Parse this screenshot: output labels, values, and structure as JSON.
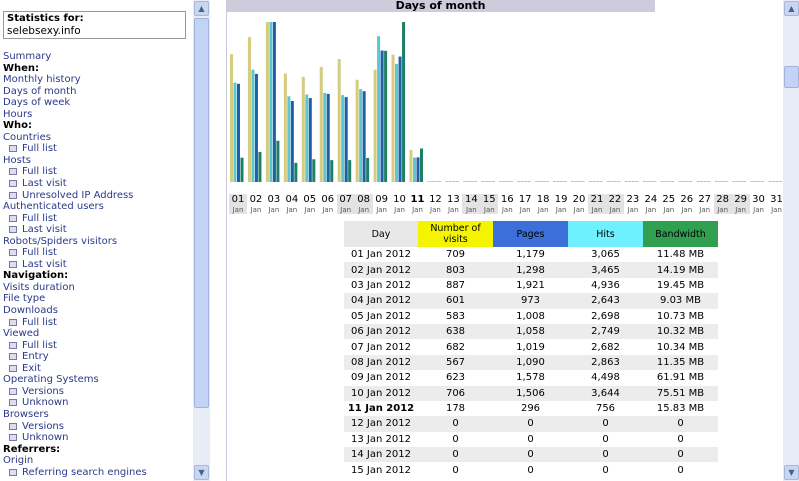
{
  "sidebar": {
    "stats_for_label": "Statistics for:",
    "domain": "selebsexy.info",
    "items": [
      {
        "label": "Summary",
        "type": "link"
      },
      {
        "label": "When:",
        "type": "head"
      },
      {
        "label": "Monthly history",
        "type": "link"
      },
      {
        "label": "Days of month",
        "type": "link"
      },
      {
        "label": "Days of week",
        "type": "link"
      },
      {
        "label": "Hours",
        "type": "link"
      },
      {
        "label": "Who:",
        "type": "head"
      },
      {
        "label": "Countries",
        "type": "link"
      },
      {
        "label": "Full list",
        "type": "sub"
      },
      {
        "label": "Hosts",
        "type": "link"
      },
      {
        "label": "Full list",
        "type": "sub"
      },
      {
        "label": "Last visit",
        "type": "sub"
      },
      {
        "label": "Unresolved IP Address",
        "type": "sub"
      },
      {
        "label": "Authenticated users",
        "type": "link"
      },
      {
        "label": "Full list",
        "type": "sub"
      },
      {
        "label": "Last visit",
        "type": "sub"
      },
      {
        "label": "Robots/Spiders visitors",
        "type": "link"
      },
      {
        "label": "Full list",
        "type": "sub"
      },
      {
        "label": "Last visit",
        "type": "sub"
      },
      {
        "label": "Navigation:",
        "type": "head"
      },
      {
        "label": "Visits duration",
        "type": "link"
      },
      {
        "label": "File type",
        "type": "link"
      },
      {
        "label": "Downloads",
        "type": "link"
      },
      {
        "label": "Full list",
        "type": "sub"
      },
      {
        "label": "Viewed",
        "type": "link"
      },
      {
        "label": "Full list",
        "type": "sub"
      },
      {
        "label": "Entry",
        "type": "sub"
      },
      {
        "label": "Exit",
        "type": "sub"
      },
      {
        "label": "Operating Systems",
        "type": "link"
      },
      {
        "label": "Versions",
        "type": "sub"
      },
      {
        "label": "Unknown",
        "type": "sub"
      },
      {
        "label": "Browsers",
        "type": "link"
      },
      {
        "label": "Versions",
        "type": "sub"
      },
      {
        "label": "Unknown",
        "type": "sub"
      },
      {
        "label": "Referrers:",
        "type": "head"
      },
      {
        "label": "Origin",
        "type": "link"
      },
      {
        "label": "Referring search engines",
        "type": "sub"
      }
    ]
  },
  "main": {
    "section_title": "Days of month"
  },
  "colors": {
    "visits": "#d4cc7e",
    "pages": "#1f5fa8",
    "hits": "#5cc6d2",
    "bandwidth": "#1c7f66"
  },
  "chart_data": {
    "type": "bar",
    "month_label": "Jan",
    "today_index": 10,
    "weekend_days": [
      1,
      7,
      8,
      14,
      15,
      21,
      22,
      28,
      29
    ],
    "categories": [
      "01",
      "02",
      "03",
      "04",
      "05",
      "06",
      "07",
      "08",
      "09",
      "10",
      "11",
      "12",
      "13",
      "14",
      "15",
      "16",
      "17",
      "18",
      "19",
      "20",
      "21",
      "22",
      "23",
      "24",
      "25",
      "26",
      "27",
      "28",
      "29",
      "30",
      "31"
    ],
    "series": [
      {
        "name": "Number of visits",
        "values": [
          709,
          803,
          887,
          601,
          583,
          638,
          682,
          567,
          623,
          706,
          178,
          0,
          0,
          0,
          0,
          0,
          0,
          0,
          0,
          0,
          0,
          0,
          0,
          0,
          0,
          0,
          0,
          0,
          0,
          0,
          0
        ]
      },
      {
        "name": "Pages",
        "values": [
          1179,
          1298,
          1921,
          973,
          1008,
          1058,
          1019,
          1090,
          1578,
          1506,
          296,
          0,
          0,
          0,
          0,
          0,
          0,
          0,
          0,
          0,
          0,
          0,
          0,
          0,
          0,
          0,
          0,
          0,
          0,
          0,
          0
        ]
      },
      {
        "name": "Hits",
        "values": [
          3065,
          3465,
          4936,
          2643,
          2698,
          2749,
          2682,
          2863,
          4498,
          3644,
          756,
          0,
          0,
          0,
          0,
          0,
          0,
          0,
          0,
          0,
          0,
          0,
          0,
          0,
          0,
          0,
          0,
          0,
          0,
          0,
          0
        ]
      },
      {
        "name": "Bandwidth",
        "values": [
          11.48,
          14.19,
          19.45,
          9.03,
          10.73,
          10.32,
          10.34,
          11.35,
          61.91,
          75.51,
          15.83,
          0,
          0,
          0,
          0,
          0,
          0,
          0,
          0,
          0,
          0,
          0,
          0,
          0,
          0,
          0,
          0,
          0,
          0,
          0,
          0
        ]
      }
    ]
  },
  "table": {
    "headers": {
      "day": "Day",
      "visits": "Number of visits",
      "pages": "Pages",
      "hits": "Hits",
      "bandwidth": "Bandwidth"
    },
    "rows": [
      {
        "day": "01 Jan 2012",
        "visits": "709",
        "pages": "1,179",
        "hits": "3,065",
        "bandwidth": "11.48 MB"
      },
      {
        "day": "02 Jan 2012",
        "visits": "803",
        "pages": "1,298",
        "hits": "3,465",
        "bandwidth": "14.19 MB"
      },
      {
        "day": "03 Jan 2012",
        "visits": "887",
        "pages": "1,921",
        "hits": "4,936",
        "bandwidth": "19.45 MB"
      },
      {
        "day": "04 Jan 2012",
        "visits": "601",
        "pages": "973",
        "hits": "2,643",
        "bandwidth": "9.03 MB"
      },
      {
        "day": "05 Jan 2012",
        "visits": "583",
        "pages": "1,008",
        "hits": "2,698",
        "bandwidth": "10.73 MB"
      },
      {
        "day": "06 Jan 2012",
        "visits": "638",
        "pages": "1,058",
        "hits": "2,749",
        "bandwidth": "10.32 MB"
      },
      {
        "day": "07 Jan 2012",
        "visits": "682",
        "pages": "1,019",
        "hits": "2,682",
        "bandwidth": "10.34 MB"
      },
      {
        "day": "08 Jan 2012",
        "visits": "567",
        "pages": "1,090",
        "hits": "2,863",
        "bandwidth": "11.35 MB"
      },
      {
        "day": "09 Jan 2012",
        "visits": "623",
        "pages": "1,578",
        "hits": "4,498",
        "bandwidth": "61.91 MB"
      },
      {
        "day": "10 Jan 2012",
        "visits": "706",
        "pages": "1,506",
        "hits": "3,644",
        "bandwidth": "75.51 MB"
      },
      {
        "day": "11 Jan 2012",
        "visits": "178",
        "pages": "296",
        "hits": "756",
        "bandwidth": "15.83 MB"
      },
      {
        "day": "12 Jan 2012",
        "visits": "0",
        "pages": "0",
        "hits": "0",
        "bandwidth": "0"
      },
      {
        "day": "13 Jan 2012",
        "visits": "0",
        "pages": "0",
        "hits": "0",
        "bandwidth": "0"
      },
      {
        "day": "14 Jan 2012",
        "visits": "0",
        "pages": "0",
        "hits": "0",
        "bandwidth": "0"
      },
      {
        "day": "15 Jan 2012",
        "visits": "0",
        "pages": "0",
        "hits": "0",
        "bandwidth": "0"
      }
    ]
  }
}
